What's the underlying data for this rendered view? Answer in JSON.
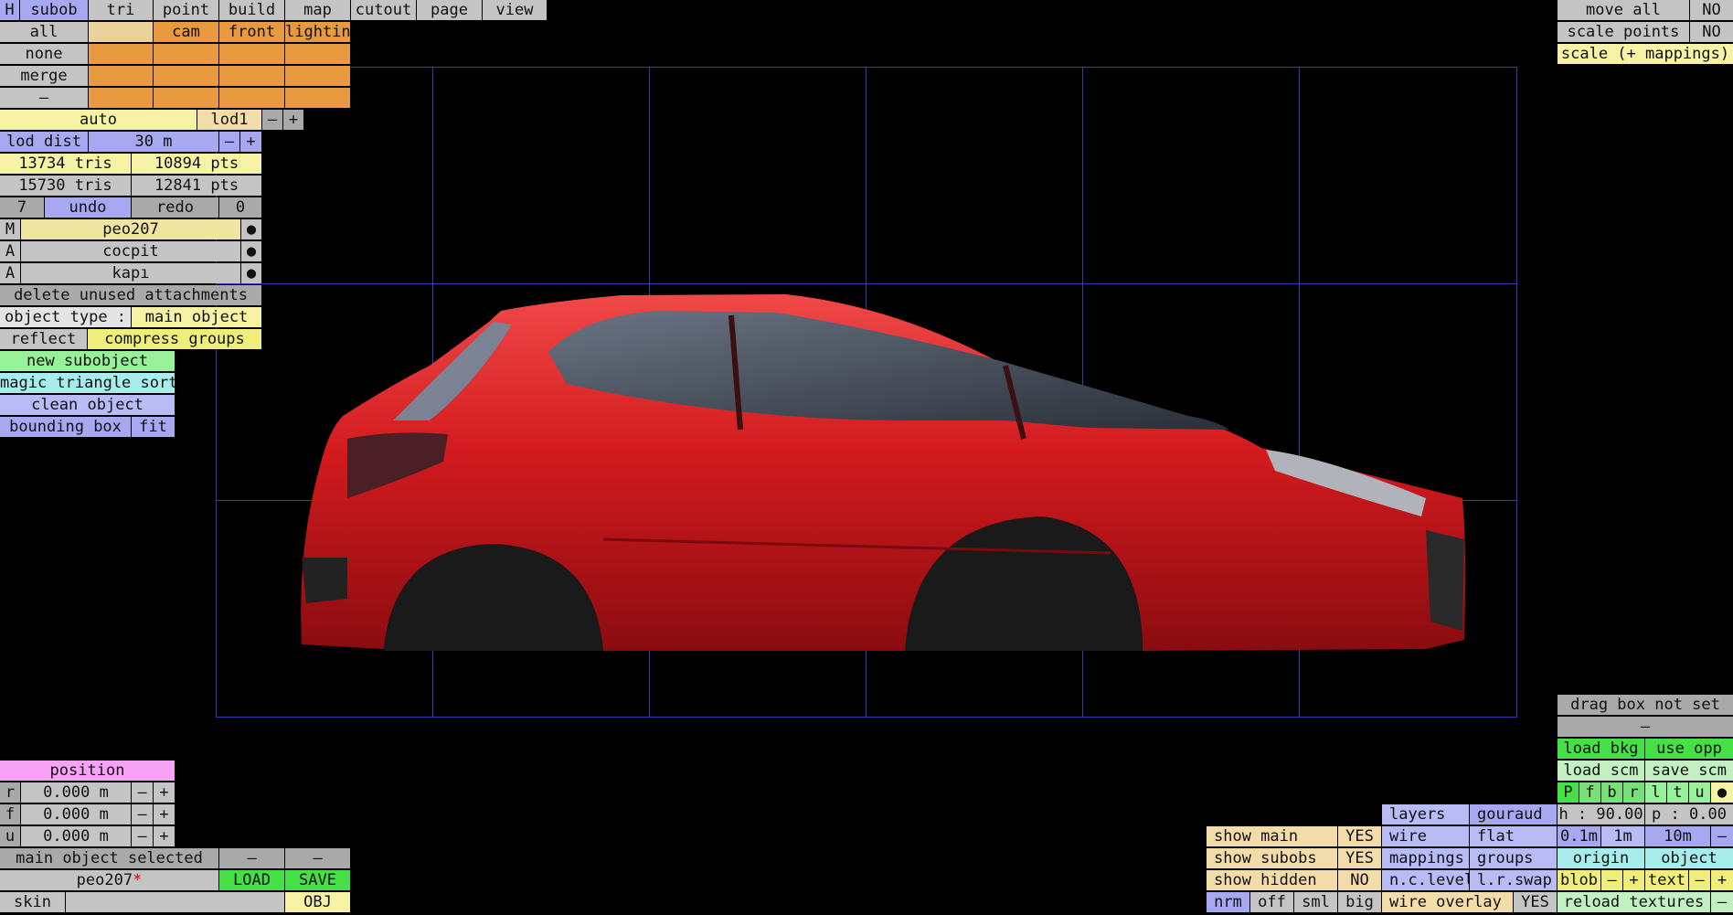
{
  "menu": {
    "h": "H",
    "tabs": [
      "subob",
      "tri",
      "point",
      "build",
      "map",
      "cutout",
      "page",
      "view"
    ]
  },
  "row_all": {
    "label": "all",
    "cells": [
      "",
      "cam",
      "front",
      "lightin"
    ]
  },
  "row_none": {
    "label": "none"
  },
  "row_merge": {
    "label": "merge"
  },
  "row_dash": {
    "label": "–"
  },
  "lod": {
    "auto": "auto",
    "name": "lod1",
    "minus": "–",
    "plus": "+"
  },
  "lod_dist": {
    "label": "lod dist",
    "value": "30 m",
    "minus": "–",
    "plus": "+"
  },
  "stats": {
    "tris1": "13734 tris",
    "pts1": "10894 pts",
    "tris2": "15730 tris",
    "pts2": "12841 pts"
  },
  "undo": {
    "count": "7",
    "undo": "undo",
    "redo": "redo",
    "redo_count": "0"
  },
  "attachments": [
    {
      "type": "M",
      "name": "peo207",
      "dot": "●"
    },
    {
      "type": "A",
      "name": "cocpit",
      "dot": "●"
    },
    {
      "type": "A",
      "name": "kapı",
      "dot": "●"
    }
  ],
  "delete_unused": "delete unused attachments",
  "object_type": {
    "label": "object type :",
    "value": "main object"
  },
  "reflect": "reflect",
  "compress_groups": "compress groups",
  "new_subobject": "new subobject",
  "magic_sort": "magic triangle sort",
  "clean_object": "clean object",
  "bounding_box": {
    "label": "bounding box",
    "fit": "fit"
  },
  "position": {
    "title": "position",
    "rows": [
      {
        "axis": "r",
        "value": "0.000 m",
        "minus": "–",
        "plus": "+"
      },
      {
        "axis": "f",
        "value": "0.000 m",
        "minus": "–",
        "plus": "+"
      },
      {
        "axis": "u",
        "value": "0.000 m",
        "minus": "–",
        "plus": "+"
      }
    ]
  },
  "selection": {
    "text": "main object selected",
    "b1": "–",
    "b2": "–"
  },
  "file": {
    "name": "peo207",
    "modified": "*",
    "load": "LOAD",
    "save": "SAVE",
    "skin": "skin",
    "obj": "OBJ"
  },
  "top_right": {
    "move_all": "move all",
    "move_all_val": "NO",
    "scale_points": "scale points",
    "scale_points_val": "NO",
    "scale_mappings": "scale (+ mappings)"
  },
  "bottom_right": {
    "drag_box": "drag box not set",
    "dash": "–",
    "load_bkg": "load bkg",
    "use_opp": "use opp",
    "load_scm": "load scm",
    "save_scm": "save scm",
    "views": [
      "P",
      "f",
      "b",
      "r",
      "l",
      "t",
      "u",
      "●"
    ],
    "h": "h : 90.00",
    "p": "p : 0.00",
    "grid": [
      "0.1m",
      "1m",
      "10m",
      "–"
    ],
    "origin": "origin",
    "object": "object",
    "blob": "blob",
    "blob_minus": "–",
    "blob_plus": "+",
    "text": "text",
    "text_minus": "–",
    "text_plus": "+",
    "reload": "reload textures",
    "reload_dash": "–"
  },
  "display": {
    "show_main": "show main",
    "show_main_val": "YES",
    "show_subobs": "show subobs",
    "show_subobs_val": "YES",
    "show_hidden": "show hidden",
    "show_hidden_val": "NO",
    "nrm": "nrm",
    "off": "off",
    "sml": "sml",
    "big": "big",
    "layers": "layers",
    "gouraud": "gouraud",
    "wire": "wire",
    "flat": "flat",
    "mappings": "mappings",
    "groups": "groups",
    "nc_level": "n.c.level",
    "lr_swap": "l.r.swap",
    "wire_overlay": "wire overlay",
    "wire_overlay_val": "YES"
  },
  "colors": {
    "car_body": "#d21a1e",
    "grid": "#3a3ab0",
    "background": "#000000"
  }
}
